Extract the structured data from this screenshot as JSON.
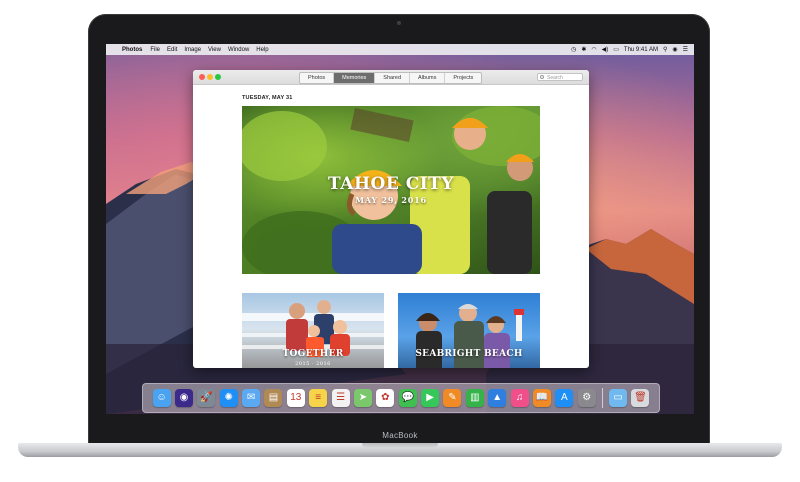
{
  "device": {
    "brand_label": "MacBook"
  },
  "menubar": {
    "apple_glyph": "",
    "app_name": "Photos",
    "items": [
      "File",
      "Edit",
      "Image",
      "View",
      "Window",
      "Help"
    ],
    "clock": "Thu 9:41 AM"
  },
  "window": {
    "tabs": [
      {
        "label": "Photos",
        "active": false
      },
      {
        "label": "Memories",
        "active": true
      },
      {
        "label": "Shared",
        "active": false
      },
      {
        "label": "Albums",
        "active": false
      },
      {
        "label": "Projects",
        "active": false
      }
    ],
    "search_placeholder": "Search",
    "date_header": "TUESDAY, MAY 31"
  },
  "memories": {
    "hero": {
      "title": "TAHOE CITY",
      "date": "MAY 29, 2016"
    },
    "cards": [
      {
        "title": "TOGETHER",
        "date": "2015 · 2016"
      },
      {
        "title": "SEABRIGHT BEACH",
        "date": ""
      }
    ]
  },
  "dock": {
    "apps": [
      {
        "name": "finder-icon",
        "glyph": "☺",
        "color": "#4aa3f0"
      },
      {
        "name": "siri-icon",
        "glyph": "◉",
        "color": "#3b2a8c"
      },
      {
        "name": "launchpad-icon",
        "glyph": "🚀",
        "color": "#7d8a96"
      },
      {
        "name": "safari-icon",
        "glyph": "✺",
        "color": "#1f8ef5"
      },
      {
        "name": "mail-icon",
        "glyph": "✉",
        "color": "#5aa9f2"
      },
      {
        "name": "contacts-icon",
        "glyph": "▤",
        "color": "#b08a55"
      },
      {
        "name": "calendar-icon",
        "glyph": "13",
        "color": "#ffffff"
      },
      {
        "name": "notes-icon",
        "glyph": "≡",
        "color": "#f7d34a"
      },
      {
        "name": "reminders-icon",
        "glyph": "☰",
        "color": "#f2f2f2"
      },
      {
        "name": "maps-icon",
        "glyph": "➤",
        "color": "#7bc86c"
      },
      {
        "name": "photos-icon",
        "glyph": "✿",
        "color": "#ffffff"
      },
      {
        "name": "messages-icon",
        "glyph": "💬",
        "color": "#3fbf4f"
      },
      {
        "name": "facetime-icon",
        "glyph": "▶",
        "color": "#35c759"
      },
      {
        "name": "pages-icon",
        "glyph": "✎",
        "color": "#f08a24"
      },
      {
        "name": "numbers-icon",
        "glyph": "▥",
        "color": "#35b34a"
      },
      {
        "name": "keynote-icon",
        "glyph": "▲",
        "color": "#2f7fe0"
      },
      {
        "name": "itunes-icon",
        "glyph": "♫",
        "color": "#f04f8a"
      },
      {
        "name": "ibooks-icon",
        "glyph": "📖",
        "color": "#f08a24"
      },
      {
        "name": "app-store-icon",
        "glyph": "A",
        "color": "#1f8ef5"
      },
      {
        "name": "system-preferences-icon",
        "glyph": "⚙",
        "color": "#8a8a8e"
      }
    ],
    "trailing": [
      {
        "name": "downloads-folder-icon",
        "glyph": "▭",
        "color": "#6fb8f0"
      },
      {
        "name": "trash-icon",
        "glyph": "🗑",
        "color": "#d8dadd"
      }
    ]
  }
}
